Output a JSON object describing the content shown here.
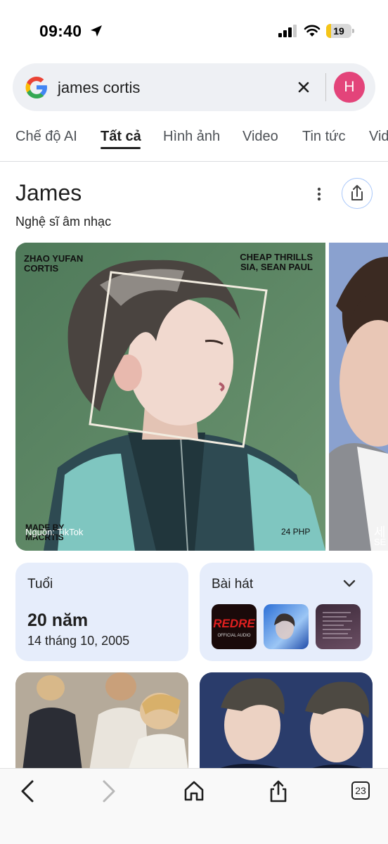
{
  "status_bar": {
    "time": "09:40",
    "battery_level": "19",
    "battery_fraction": 0.19
  },
  "search": {
    "query": "james cortis",
    "avatar_letter": "H"
  },
  "tabs": [
    {
      "label": "Chế độ AI",
      "active": false
    },
    {
      "label": "Tất cả",
      "active": true
    },
    {
      "label": "Hình ảnh",
      "active": false
    },
    {
      "label": "Video",
      "active": false
    },
    {
      "label": "Tin tức",
      "active": false
    },
    {
      "label": "Vid",
      "active": false
    }
  ],
  "entity": {
    "title": "James",
    "subtitle": "Nghệ sĩ âm nhạc"
  },
  "hero_image": {
    "top_left_line1": "ZHAO YUFAN",
    "top_left_line2": "CORTIS",
    "top_right_line1": "CHEAP THRILLS",
    "top_right_line2": "SIA, SEAN PAUL",
    "bottom_left_line1": "MADE BY",
    "bottom_left_line2": "MACRTIS",
    "source": "Nguồn: TikTok",
    "duration": "24 PHP"
  },
  "side_image": {
    "caption": "세",
    "caption2": "SE"
  },
  "age_card": {
    "label": "Tuổi",
    "value": "20 năm",
    "date": "14 tháng 10, 2005"
  },
  "songs_card": {
    "label": "Bài hát",
    "thumb1_text": "REDRE",
    "thumb1_sub": "OFFICIAL AUDIO"
  },
  "toolbar": {
    "tab_count": "23"
  },
  "colors": {
    "avatar": "#e3447a",
    "card_bg": "#e6edfb",
    "accent": "#a8c7fa"
  }
}
